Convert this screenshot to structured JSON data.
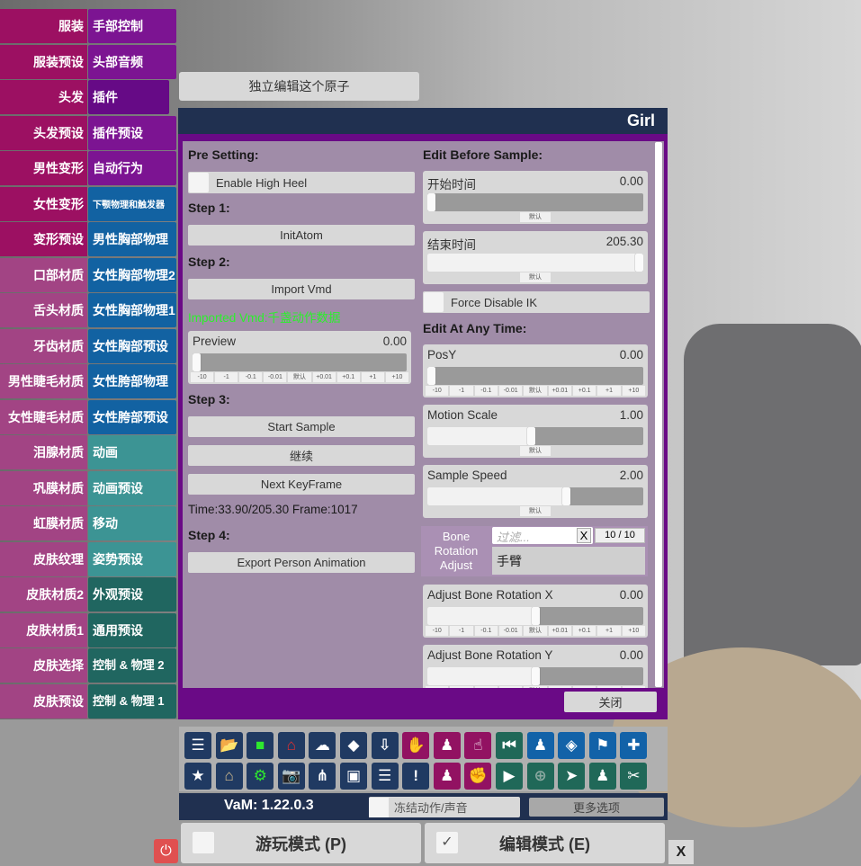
{
  "sidebar": {
    "left": [
      "服装",
      "服装预设",
      "头发",
      "头发预设",
      "男性变形",
      "女性变形",
      "变形预设",
      "口部材质",
      "舌头材质",
      "牙齿材质",
      "男性睫毛材质",
      "女性睫毛材质",
      "泪腺材质",
      "巩膜材质",
      "虹膜材质",
      "皮肤纹理",
      "皮肤材质2",
      "皮肤材质1",
      "皮肤选择",
      "皮肤预设"
    ],
    "right": [
      "手部控制",
      "头部音频",
      "插件",
      "插件预设",
      "自动行为",
      "下颚物理和触发器",
      "男性胸部物理",
      "女性胸部物理2",
      "女性胸部物理1",
      "女性胸部预设",
      "女性胯部物理",
      "女性胯部预设",
      "动画",
      "动画预设",
      "移动",
      "姿势预设",
      "外观预设",
      "通用预设",
      "控制 & 物理 2",
      "控制 & 物理 1"
    ],
    "colors": {
      "left_dark": "#9c1062",
      "left_light": "#a24484",
      "purple": "#7c1492",
      "purple_selected": "#660a86",
      "blue": "#1262a2",
      "teal": "#3c9494",
      "teal_dark": "#206660"
    }
  },
  "top_button": "独立编辑这个原子",
  "panel": {
    "title": "Girl",
    "close": "关闭",
    "left": {
      "pre_setting": "Pre Setting:",
      "high_heel": "Enable High Heel",
      "step1": "Step 1:",
      "init_atom": "InitAtom",
      "step2": "Step 2:",
      "import_vmd": "Import Vmd",
      "imported": "Imported Vmd:千盏动作数据",
      "preview": {
        "label": "Preview",
        "value": "0.00",
        "fill": 0
      },
      "step3": "Step 3:",
      "start_sample": "Start Sample",
      "continue": "继续",
      "next_keyframe": "Next KeyFrame",
      "time": "Time:33.90/205.30 Frame:1017",
      "step4": "Step 4:",
      "export": "Export Person Animation"
    },
    "right": {
      "edit_before": "Edit Before Sample:",
      "start_time": {
        "label": "开始时间",
        "value": "0.00",
        "fill": 0
      },
      "end_time": {
        "label": "结束时间",
        "value": "205.30",
        "fill": 1
      },
      "force_ik": "Force Disable IK",
      "edit_any": "Edit At Any Time:",
      "posy": {
        "label": "PosY",
        "value": "0.00",
        "fill": 0
      },
      "motion_scale": {
        "label": "Motion Scale",
        "value": "1.00",
        "fill": 0.48
      },
      "sample_speed": {
        "label": "Sample Speed",
        "value": "2.00",
        "fill": 0.65
      },
      "bone": {
        "label": "Bone Rotation Adjust",
        "filter_placeholder": "过滤...",
        "clear": "X",
        "count": "10 / 10",
        "selected": "手臂"
      },
      "rot_x": {
        "label": "Adjust Bone Rotation X",
        "value": "0.00",
        "fill": 0.5
      },
      "rot_y": {
        "label": "Adjust Bone Rotation Y",
        "value": "0.00",
        "fill": 0.5
      }
    },
    "step_buttons": [
      "-10",
      "-1",
      "-0.1",
      "-0.01",
      "默认",
      "+0.01",
      "+0.1",
      "+1",
      "+10"
    ],
    "default_button": "默认"
  },
  "toolbar": {
    "row1": [
      [
        "menu-icon",
        "☰",
        "#203a62"
      ],
      [
        "folder-open-icon",
        "📂",
        "#203a62"
      ],
      [
        "folder-icon",
        "■",
        "#203a62"
      ],
      [
        "folder-red-icon",
        "⌂",
        "#203a62"
      ],
      [
        "cloud-download-icon",
        "☁",
        "#203a62"
      ],
      [
        "cube-icon",
        "◆",
        "#203a62"
      ],
      [
        "inbox-download-icon",
        "⇩",
        "#203a62"
      ],
      [
        "hand-icon",
        "✋",
        "#921262"
      ],
      [
        "add-person-icon",
        "♟",
        "#921262"
      ],
      [
        "touch-icon",
        "☝",
        "#921262"
      ],
      [
        "skip-back-icon",
        "⏮",
        "#206858"
      ],
      [
        "person-icon",
        "♟",
        "#1262a8"
      ],
      [
        "unity-icon",
        "◈",
        "#1262a8"
      ],
      [
        "flag-icon",
        "⚑",
        "#1262a8"
      ],
      [
        "plus-icon",
        "✚",
        "#1262a8"
      ]
    ],
    "row2": [
      [
        "star-icon",
        "★",
        "#203a62"
      ],
      [
        "folder-open-tan-icon",
        "⌂",
        "#203a62"
      ],
      [
        "folder-gear-icon",
        "⚙",
        "#203a62"
      ],
      [
        "camera-icon",
        "📷",
        "#203a62"
      ],
      [
        "share-nodes-icon",
        "⋔",
        "#203a62"
      ],
      [
        "open-box-icon",
        "▣",
        "#203a62"
      ],
      [
        "document-icon",
        "☰",
        "#203a62"
      ],
      [
        "alert-icon",
        "!",
        "#203a62"
      ],
      [
        "remove-person-icon",
        "♟",
        "#921262"
      ],
      [
        "grab-icon",
        "✊",
        "#921262"
      ],
      [
        "play-icon",
        "▶",
        "#206858"
      ],
      [
        "crosshair-icon",
        "⊕",
        "#206858"
      ],
      [
        "cursor-icon",
        "➤",
        "#206858"
      ],
      [
        "people-icon",
        "♟",
        "#206858"
      ],
      [
        "tools-icon",
        "✂",
        "#206858"
      ]
    ]
  },
  "status": {
    "version": "VaM: 1.22.0.3",
    "freeze": "冻结动作/声音",
    "more": "更多选项"
  },
  "modes": {
    "play": "游玩模式 (P)",
    "edit": "编辑模式 (E)",
    "edit_check": "✓",
    "close": "X",
    "power": "⏻"
  }
}
